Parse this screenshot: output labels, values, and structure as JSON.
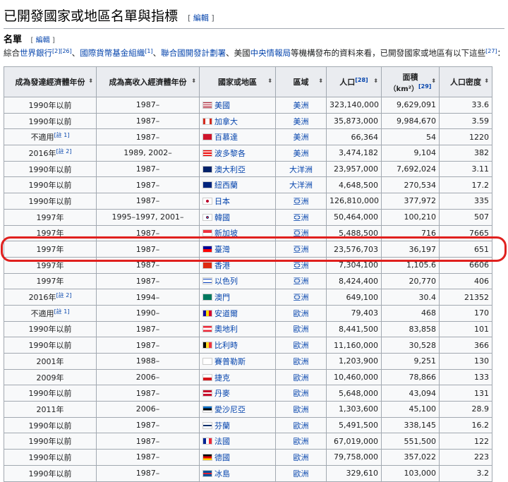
{
  "section": {
    "title": "已開發國家或地區名單與指標",
    "edit_label": "編輯"
  },
  "subsection": {
    "title": "名單",
    "edit_label": "編輯"
  },
  "intro": {
    "p1": "綜合",
    "link1": "世界銀行",
    "ref1": "[2][26]",
    "p2": "、",
    "link2": "國際貨幣基金組織",
    "ref2": "[1]",
    "p3": "、",
    "link3": "聯合國開發計劃署",
    "p4": "、美國",
    "link4": "中央情報局",
    "p5": "等機構發布的資料來看，已開發國家或地區有以下這些",
    "ref3": "[27]",
    "p6": "："
  },
  "table": {
    "headers": {
      "developed_year": "成為發達經濟體年份",
      "high_income_year": "成為高收入經濟體年份",
      "country": "國家或地區",
      "region": "區域",
      "population": "人口",
      "population_ref": "[28]",
      "area": "面積",
      "area_unit": "（km²）",
      "area_ref": "[29]",
      "density": "人口密度"
    },
    "rows": [
      {
        "developed": "1990年以前",
        "note": "",
        "high_income": "1987–",
        "flag": "us",
        "country": "美國",
        "region": "美洲",
        "population": "323,140,000",
        "area": "9,629,091",
        "density": "33.6"
      },
      {
        "developed": "1990年以前",
        "note": "",
        "high_income": "1987–",
        "flag": "ca",
        "country": "加拿大",
        "region": "美洲",
        "population": "35,873,000",
        "area": "9,984,670",
        "density": "3.59"
      },
      {
        "developed": "不適用",
        "note": "[註 1]",
        "high_income": "1987–",
        "flag": "bm",
        "country": "百慕達",
        "region": "美洲",
        "population": "66,364",
        "area": "54",
        "density": "1220"
      },
      {
        "developed": "2016年",
        "note": "[註 2]",
        "high_income": "1989, 2002–",
        "flag": "pr",
        "country": "波多黎各",
        "region": "美洲",
        "population": "3,474,182",
        "area": "9,104",
        "density": "382"
      },
      {
        "developed": "1990年以前",
        "note": "",
        "high_income": "1987–",
        "flag": "au",
        "country": "澳大利亞",
        "region": "大洋洲",
        "population": "23,957,000",
        "area": "7,692,024",
        "density": "3.11"
      },
      {
        "developed": "1990年以前",
        "note": "",
        "high_income": "1987–",
        "flag": "nz",
        "country": "紐西蘭",
        "region": "大洋洲",
        "population": "4,648,500",
        "area": "270,534",
        "density": "17.2"
      },
      {
        "developed": "1990年以前",
        "note": "",
        "high_income": "1987–",
        "flag": "jp",
        "country": "日本",
        "region": "亞洲",
        "population": "126,810,000",
        "area": "377,972",
        "density": "335"
      },
      {
        "developed": "1997年",
        "note": "",
        "high_income": "1995–1997, 2001–",
        "flag": "kr",
        "country": "韓國",
        "region": "亞洲",
        "population": "50,464,000",
        "area": "100,210",
        "density": "507"
      },
      {
        "developed": "1997年",
        "note": "",
        "high_income": "1987–",
        "flag": "sg",
        "country": "新加坡",
        "region": "亞洲",
        "population": "5,488,500",
        "area": "716",
        "density": "7665"
      },
      {
        "developed": "1997年",
        "note": "",
        "high_income": "1987–",
        "flag": "tw",
        "country": "臺灣",
        "region": "亞洲",
        "population": "23,576,703",
        "area": "36,197",
        "density": "651"
      },
      {
        "developed": "1997年",
        "note": "",
        "high_income": "1987–",
        "flag": "hk",
        "country": "香港",
        "region": "亞洲",
        "population": "7,304,100",
        "area": "1,105.6",
        "density": "6606"
      },
      {
        "developed": "1997年",
        "note": "",
        "high_income": "1987–",
        "flag": "il",
        "country": "以色列",
        "region": "亞洲",
        "population": "8,424,400",
        "area": "20,770",
        "density": "406"
      },
      {
        "developed": "2016年",
        "note": "[註 2]",
        "high_income": "1994–",
        "flag": "mo",
        "country": "澳門",
        "region": "亞洲",
        "population": "649,100",
        "area": "30.4",
        "density": "21352"
      },
      {
        "developed": "不適用",
        "note": "[註 1]",
        "high_income": "1990–",
        "flag": "ad",
        "country": "安道爾",
        "region": "歐洲",
        "population": "79,403",
        "area": "468",
        "density": "170"
      },
      {
        "developed": "1990年以前",
        "note": "",
        "high_income": "1987–",
        "flag": "at",
        "country": "奧地利",
        "region": "歐洲",
        "population": "8,441,500",
        "area": "83,858",
        "density": "101"
      },
      {
        "developed": "1990年以前",
        "note": "",
        "high_income": "1987–",
        "flag": "be",
        "country": "比利時",
        "region": "歐洲",
        "population": "11,160,000",
        "area": "30,528",
        "density": "366"
      },
      {
        "developed": "2001年",
        "note": "",
        "high_income": "1988–",
        "flag": "cy",
        "country": "賽普勒斯",
        "region": "歐洲",
        "population": "1,203,900",
        "area": "9,251",
        "density": "130"
      },
      {
        "developed": "2009年",
        "note": "",
        "high_income": "2006–",
        "flag": "cz",
        "country": "捷克",
        "region": "歐洲",
        "population": "10,460,000",
        "area": "78,866",
        "density": "133"
      },
      {
        "developed": "1990年以前",
        "note": "",
        "high_income": "1987–",
        "flag": "dk",
        "country": "丹麥",
        "region": "歐洲",
        "population": "5,648,000",
        "area": "43,094",
        "density": "131"
      },
      {
        "developed": "2011年",
        "note": "",
        "high_income": "2006–",
        "flag": "ee",
        "country": "愛沙尼亞",
        "region": "歐洲",
        "population": "1,303,600",
        "area": "45,100",
        "density": "28.9"
      },
      {
        "developed": "1990年以前",
        "note": "",
        "high_income": "1987–",
        "flag": "fi",
        "country": "芬蘭",
        "region": "歐洲",
        "population": "5,491,500",
        "area": "338,145",
        "density": "16.2"
      },
      {
        "developed": "1990年以前",
        "note": "",
        "high_income": "1987–",
        "flag": "fr",
        "country": "法國",
        "region": "歐洲",
        "population": "67,019,000",
        "area": "551,500",
        "density": "122"
      },
      {
        "developed": "1990年以前",
        "note": "",
        "high_income": "1987–",
        "flag": "de",
        "country": "德國",
        "region": "歐洲",
        "population": "79,758,000",
        "area": "357,022",
        "density": "223"
      },
      {
        "developed": "1990年以前",
        "note": "",
        "high_income": "1987–",
        "flag": "is",
        "country": "冰島",
        "region": "歐洲",
        "population": "329,610",
        "area": "103,000",
        "density": "3.2"
      }
    ]
  },
  "colors": {
    "link": "#0645ad",
    "highlight": "#e0201e",
    "header_bg": "#eaecf0",
    "cell_bg": "#f8f9fa",
    "border": "#a2a9b1"
  },
  "highlighted_country": "臺灣",
  "flags": {
    "us": "linear-gradient(#b22234 0 15%, #fff 15% 30%, #b22234 30% 45%, #fff 45% 60%, #b22234 60% 75%, #fff 75% 90%, #b22234 90%)",
    "ca": "linear-gradient(90deg, #d52b1e 0 25%, #fff 25% 75%, #d52b1e 75%)",
    "bm": "linear-gradient(#cf142b, #cf142b)",
    "pr": "linear-gradient(#ed0000 0 20%, #fff 20% 40%, #ed0000 40% 60%, #fff 60% 80%, #ed0000 80%)",
    "au": "linear-gradient(#012169, #012169)",
    "nz": "linear-gradient(#00247d, #00247d)",
    "jp": "radial-gradient(circle, #bc002d 0 28%, #fff 30%)",
    "kr": "radial-gradient(circle, #cd2e3a 0 18%, #0047a0 19% 28%, #fff 30%)",
    "sg": "linear-gradient(#ef3340 0 50%, #fff 50%)",
    "tw": "linear-gradient(#000095 0 50%, #fe0000 50%)",
    "hk": "linear-gradient(#de2910, #de2910)",
    "il": "linear-gradient(#fff 0 15%, #0038b8 15% 28%, #fff 28% 72%, #0038b8 72% 85%, #fff 85%)",
    "mo": "linear-gradient(#00785e, #00785e)",
    "ad": "linear-gradient(90deg, #10069f 0 33%, #fedd00 33% 66%, #d50032 66%)",
    "at": "linear-gradient(#ed2939 0 33%, #fff 33% 66%, #ed2939 66%)",
    "be": "linear-gradient(90deg, #000 0 33%, #fdda24 33% 66%, #ef3340 66%)",
    "cy": "linear-gradient(#fff, #fff)",
    "cz": "linear-gradient(#fff 0 50%, #d7141a 50%)",
    "dk": "linear-gradient(#c8102e 0 40%, #fff 40% 60%, #c8102e 60%)",
    "ee": "linear-gradient(#0072ce 0 33%, #000 33% 66%, #fff 66%)",
    "fi": "linear-gradient(#fff 0 38%, #002f6c 38% 62%, #fff 62%)",
    "fr": "linear-gradient(90deg, #002395 0 33%, #fff 33% 66%, #ed2939 66%)",
    "de": "linear-gradient(#000 0 33%, #dd0000 33% 66%, #ffce00 66%)",
    "is": "linear-gradient(#02529c 0 38%, #dc1e35 38% 62%, #02529c 62%)"
  }
}
